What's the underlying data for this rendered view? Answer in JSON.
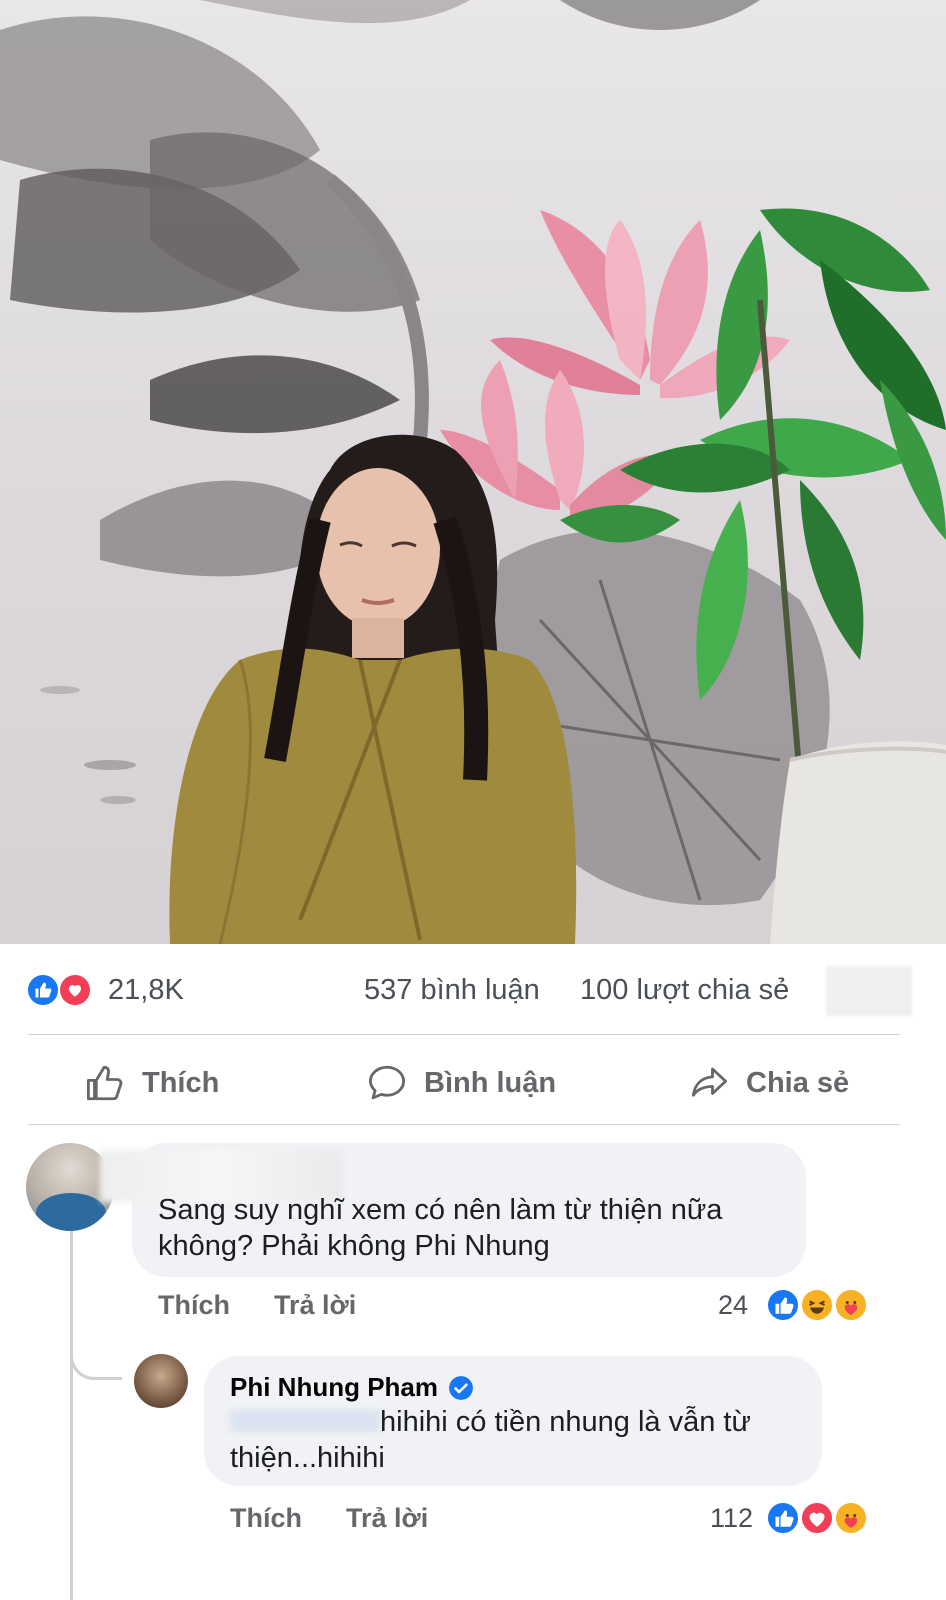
{
  "post": {
    "photo_alt": "woman-meditating-lotus-mural",
    "reaction_count": "21,8K",
    "comment_count": "537 bình luận",
    "share_count": "100 lượt chia sẻ"
  },
  "actions": {
    "like_label": "Thích",
    "comment_label": "Bình luận",
    "share_label": "Chia sẻ"
  },
  "comments": [
    {
      "text": "Sang suy nghĩ xem có nên làm từ thiện nữa không? Phải không Phi Nhung",
      "like_label": "Thích",
      "reply_label": "Trả lời",
      "reaction_count": "24"
    },
    {
      "author": "Phi Nhung Pham",
      "text": "hihihi có tiền nhung là vẫn từ thiện...hihihi",
      "like_label": "Thích",
      "reply_label": "Trả lời",
      "reaction_count": "112"
    }
  ],
  "colors": {
    "like_blue": "#1877f2",
    "love_red": "#f33e58",
    "haha_yellow": "#f7b125",
    "muted_text": "#65676b"
  }
}
